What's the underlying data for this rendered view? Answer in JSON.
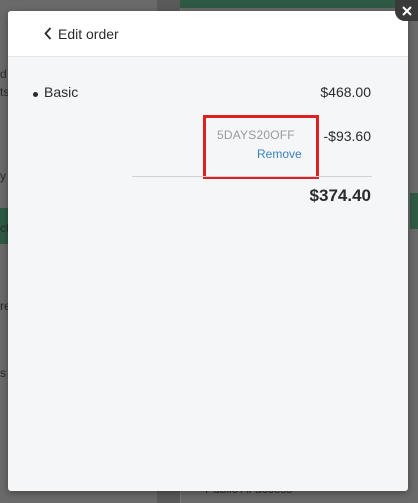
{
  "modal": {
    "back_label": "Edit order",
    "items": [
      {
        "name": "Basic",
        "price": "$468.00"
      }
    ],
    "coupon": {
      "code": "5DAYS20OFF",
      "remove_label": "Remove",
      "amount": "-$93.60"
    },
    "total": "$374.40"
  },
  "background": {
    "fragments": [
      "d",
      "ts",
      "y",
      "ct",
      "re",
      "s"
    ],
    "bottom_text": "Public AI access"
  },
  "colors": {
    "link": "#3a7fbf",
    "highlight": "#e02020",
    "accent_green": "#2e5a44"
  },
  "icons": {
    "back": "chevron-left-icon",
    "close": "close-icon"
  }
}
